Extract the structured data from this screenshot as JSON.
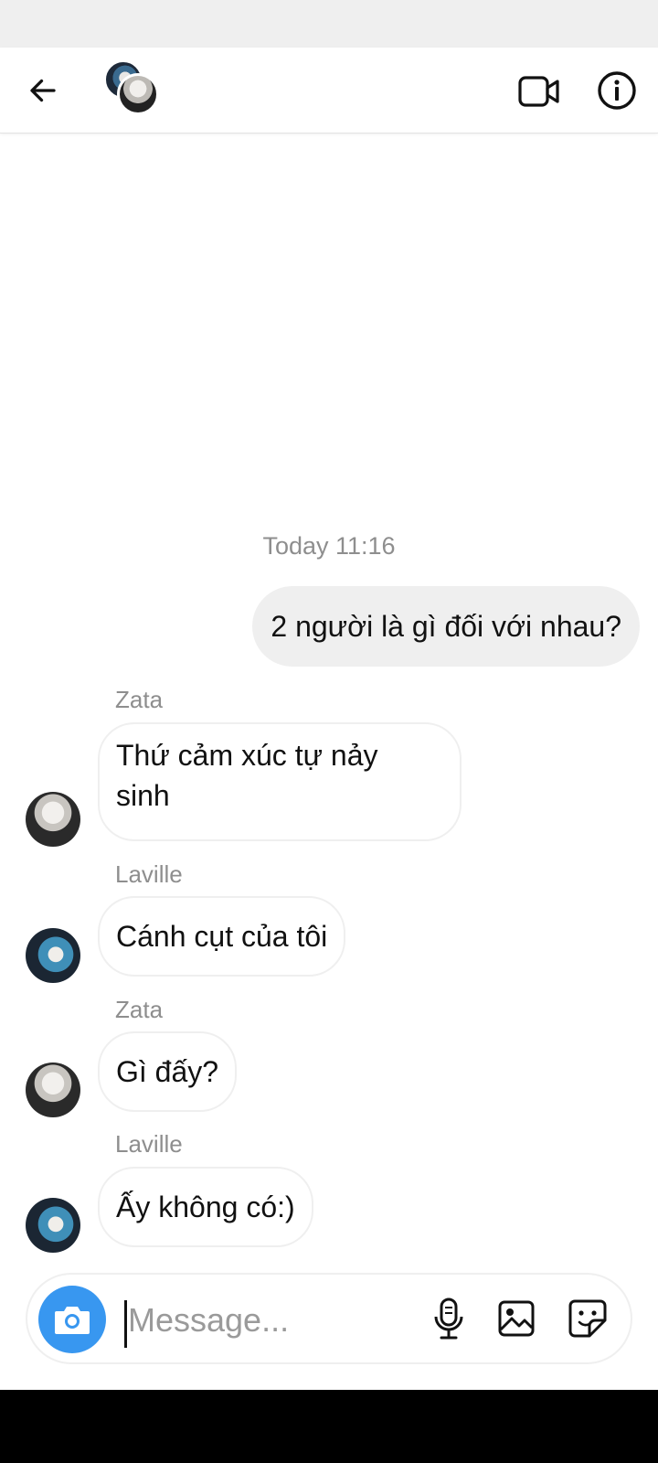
{
  "header": {
    "back_icon": "arrow-left-icon",
    "video_icon": "video-camera-icon",
    "info_icon": "info-circle-icon"
  },
  "thread": {
    "timestamp": "Today 11:16",
    "messages": [
      {
        "from": "me",
        "text": "2 người là gì đối với nhau?"
      },
      {
        "from": "Zata",
        "sender_label": "Zata",
        "text_lines": [
          "Thứ cảm xúc tự nảy",
          "sinh"
        ]
      },
      {
        "from": "Laville",
        "sender_label": "Laville",
        "text": "Cánh cụt của tôi"
      },
      {
        "from": "Zata",
        "sender_label": "Zata",
        "text": "Gì đấy?"
      },
      {
        "from": "Laville",
        "sender_label": "Laville",
        "text": "Ấy không có:)"
      }
    ]
  },
  "composer": {
    "placeholder": "Message...",
    "value": "",
    "camera_icon": "camera-icon",
    "mic_icon": "microphone-icon",
    "gallery_icon": "image-gallery-icon",
    "sticker_icon": "sticker-icon",
    "accent_color": "#3897f0"
  }
}
